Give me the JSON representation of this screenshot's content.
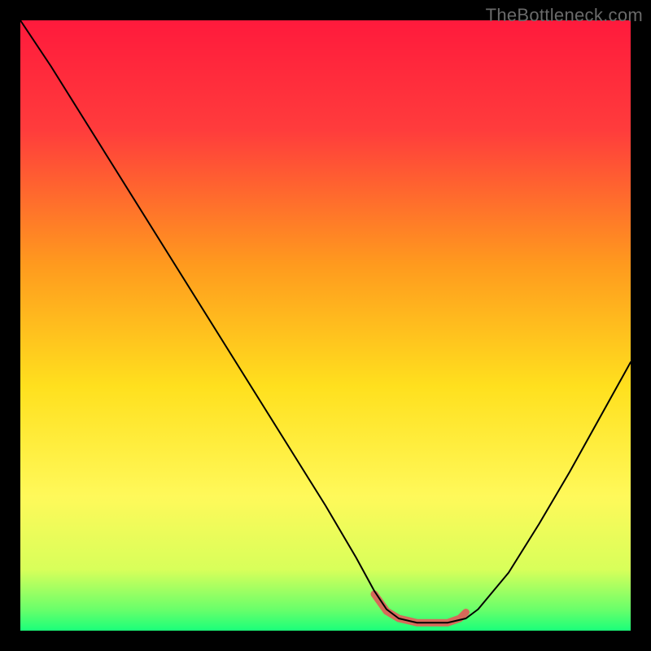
{
  "watermark": "TheBottleneck.com",
  "chart_data": {
    "type": "line",
    "title": "",
    "xlabel": "",
    "ylabel": "",
    "xlim": [
      0,
      100
    ],
    "ylim": [
      0,
      100
    ],
    "background_gradient": {
      "stops": [
        {
          "offset": 0.0,
          "color": "#ff1a3c"
        },
        {
          "offset": 0.18,
          "color": "#ff3c3c"
        },
        {
          "offset": 0.4,
          "color": "#ff9a1e"
        },
        {
          "offset": 0.6,
          "color": "#ffe01e"
        },
        {
          "offset": 0.78,
          "color": "#fff95a"
        },
        {
          "offset": 0.9,
          "color": "#d8ff5a"
        },
        {
          "offset": 0.965,
          "color": "#6aff6a"
        },
        {
          "offset": 1.0,
          "color": "#1aff7a"
        }
      ]
    },
    "series": [
      {
        "name": "bottleneck-curve",
        "color": "#000000",
        "width": 2,
        "x": [
          0.0,
          5,
          10,
          15,
          20,
          25,
          30,
          35,
          40,
          45,
          50,
          55,
          58,
          60,
          62,
          65,
          70,
          73,
          75,
          80,
          85,
          90,
          95,
          100
        ],
        "y": [
          100,
          92.5,
          84.5,
          76.5,
          68.5,
          60.5,
          52.5,
          44.5,
          36.5,
          28.5,
          20.5,
          12.0,
          6.5,
          3.5,
          2.0,
          1.3,
          1.3,
          2.0,
          3.5,
          9.5,
          17.5,
          26.0,
          35.0,
          44.0
        ]
      }
    ],
    "marker_band": {
      "name": "optimal-range",
      "color": "#d66a5a",
      "x": [
        58,
        60,
        62,
        65,
        68,
        70,
        72,
        73
      ],
      "y": [
        6.0,
        3.2,
        2.0,
        1.3,
        1.3,
        1.3,
        2.0,
        3.0
      ],
      "stroke_width": 9
    }
  }
}
